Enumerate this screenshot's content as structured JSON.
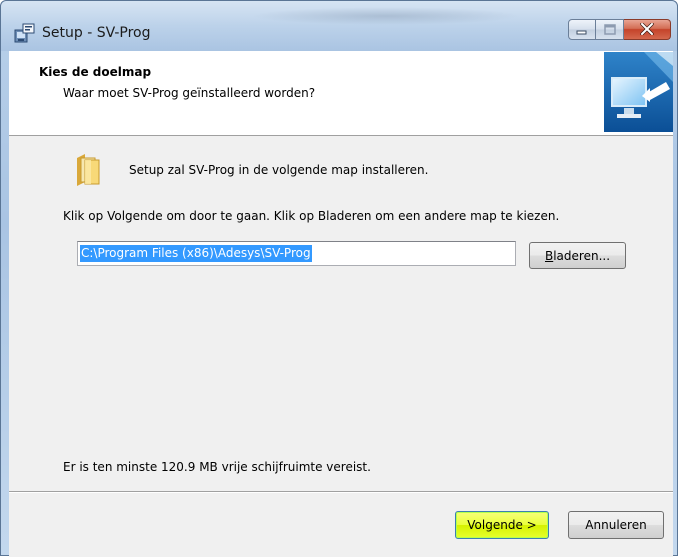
{
  "window": {
    "title": "Setup - SV-Prog",
    "icons": {
      "app": "setup-app-icon",
      "minimize": "minimize-icon",
      "maximize": "maximize-icon",
      "close": "close-icon"
    }
  },
  "header": {
    "title": "Kies de doelmap",
    "subtitle": "Waar moet SV-Prog geïnstalleerd worden?",
    "image": "wizard-computer-icon"
  },
  "body": {
    "folder_icon": "folder-icon",
    "intro": "Setup zal SV-Prog in de volgende map installeren.",
    "instruction": "Klik op Volgende om door te gaan. Klik op Bladeren om een andere map te kiezen.",
    "path_value": "C:\\Program Files (x86)\\Adesys\\SV-Prog",
    "browse_label_accel": "B",
    "browse_label_rest": "laderen...",
    "disk_space": "Er is ten minste 120.9 MB vrije schijfruimte vereist."
  },
  "footer": {
    "next_label": "Volgende >",
    "cancel_label": "Annuleren"
  },
  "colors": {
    "selection": "#3399ff",
    "next_button_highlight": "#eaff3a",
    "close_button": "#c4432a"
  }
}
